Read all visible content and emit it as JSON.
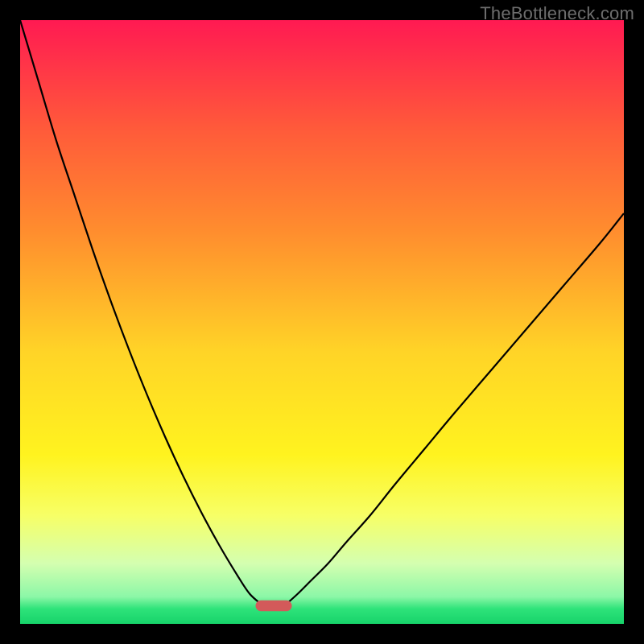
{
  "watermark": "TheBottleneck.com",
  "chart_data": {
    "type": "line",
    "title": "",
    "xlabel": "",
    "ylabel": "",
    "xlim": [
      0,
      100
    ],
    "ylim": [
      0,
      100
    ],
    "grid": false,
    "legend": false,
    "background": {
      "type": "vertical-gradient",
      "stops": [
        {
          "offset": 0.0,
          "color": "#ff1a52"
        },
        {
          "offset": 0.18,
          "color": "#ff5a3a"
        },
        {
          "offset": 0.35,
          "color": "#ff8d2e"
        },
        {
          "offset": 0.55,
          "color": "#ffd427"
        },
        {
          "offset": 0.72,
          "color": "#fff31f"
        },
        {
          "offset": 0.82,
          "color": "#f7ff66"
        },
        {
          "offset": 0.9,
          "color": "#d4ffb0"
        },
        {
          "offset": 0.955,
          "color": "#8cf7a7"
        },
        {
          "offset": 0.975,
          "color": "#2ee37a"
        },
        {
          "offset": 1.0,
          "color": "#17d36a"
        }
      ]
    },
    "series": [
      {
        "name": "bottleneck-curve-left",
        "color": "#000000",
        "x": [
          0.0,
          3.0,
          6.0,
          9.0,
          12.0,
          15.0,
          18.0,
          21.0,
          24.0,
          27.0,
          30.0,
          33.0,
          36.0,
          38.0,
          40.0
        ],
        "y": [
          100.0,
          90.0,
          80.0,
          71.0,
          62.0,
          53.5,
          45.5,
          38.0,
          31.0,
          24.5,
          18.5,
          13.0,
          8.0,
          5.0,
          3.2
        ]
      },
      {
        "name": "bottleneck-curve-right",
        "color": "#000000",
        "x": [
          44.0,
          46.0,
          48.0,
          51.0,
          54.0,
          58.0,
          62.0,
          67.0,
          72.0,
          78.0,
          84.0,
          90.0,
          96.0,
          100.0
        ],
        "y": [
          3.2,
          5.0,
          7.0,
          10.0,
          13.5,
          18.0,
          23.0,
          29.0,
          35.0,
          42.0,
          49.0,
          56.0,
          63.0,
          68.0
        ]
      }
    ],
    "highlight_marker": {
      "name": "optimal-zone",
      "shape": "rounded-rect",
      "color": "#d35a5a",
      "x_center": 42.0,
      "y_center": 3.0,
      "width": 6.0,
      "height": 1.8
    }
  }
}
